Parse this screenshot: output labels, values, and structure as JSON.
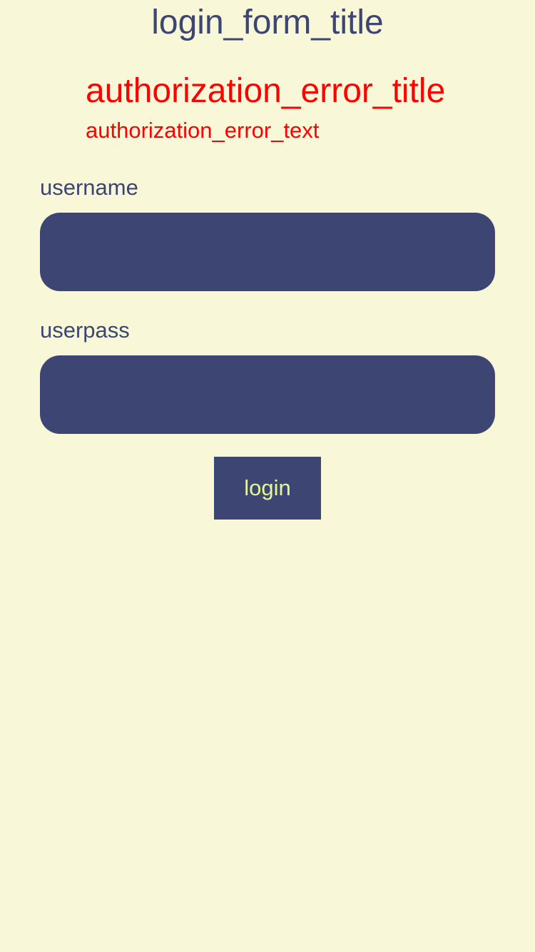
{
  "form": {
    "title": "login_form_title",
    "error_title": "authorization_error_title",
    "error_text": "authorization_error_text",
    "username_label": "username",
    "username_value": "",
    "userpass_label": "userpass",
    "userpass_value": "",
    "login_label": "login"
  },
  "colors": {
    "background": "#f8f8d8",
    "primary": "#3d4573",
    "error": "#ff0000",
    "button_text": "#e5f598"
  }
}
